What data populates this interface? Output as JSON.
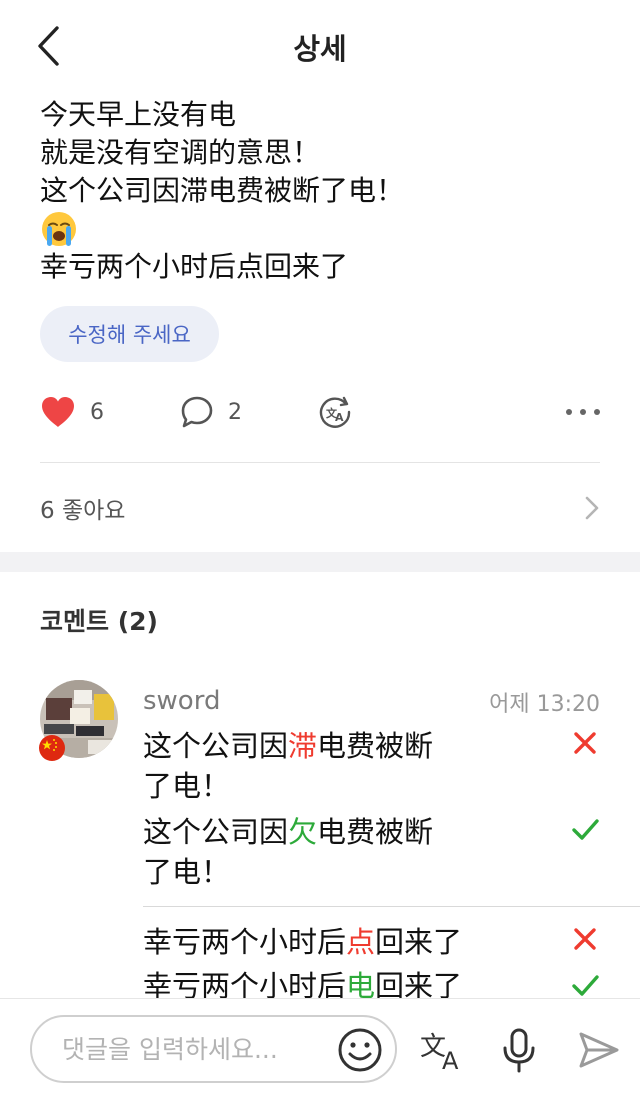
{
  "header": {
    "title": "상세"
  },
  "post": {
    "lines": [
      "今天早上没有电",
      "就是没有空调的意思！",
      "这个公司因滞电费被断了电！",
      "幸亏两个小时后点回来了"
    ],
    "correction_button": "수정해 주세요"
  },
  "actions": {
    "likes": "6",
    "comments": "2"
  },
  "likes_summary": "6 좋아요",
  "comments_section": {
    "title": "코멘트 (2)",
    "comment": {
      "username": "sword",
      "time": "어제 13:20",
      "corrections": [
        {
          "wrong": {
            "before": "这个公司因",
            "highlight": "滞",
            "after": "电费被断",
            "line2": "了电！"
          },
          "right": {
            "before": "这个公司因",
            "highlight": "欠",
            "after": "电费被断",
            "line2": "了电！"
          }
        },
        {
          "wrong": {
            "before": "幸亏两个小时后",
            "highlight": "点",
            "after": "回来了"
          },
          "right": {
            "before": "幸亏两个小时后",
            "highlight": "电",
            "after": "回来了"
          }
        }
      ]
    }
  },
  "bottom_bar": {
    "placeholder": "댓글을 입력하세요..."
  },
  "colors": {
    "like_red": "#ee4545",
    "wrong_red": "#ef3b2f",
    "right_green": "#2daa3a",
    "link_blue": "#4a66c5"
  },
  "icons": [
    "back-icon",
    "heart-icon",
    "comment-icon",
    "translate-icon",
    "more-icon",
    "chevron-right-icon",
    "cross-icon",
    "check-icon",
    "emoji-icon",
    "mic-icon",
    "send-icon"
  ]
}
